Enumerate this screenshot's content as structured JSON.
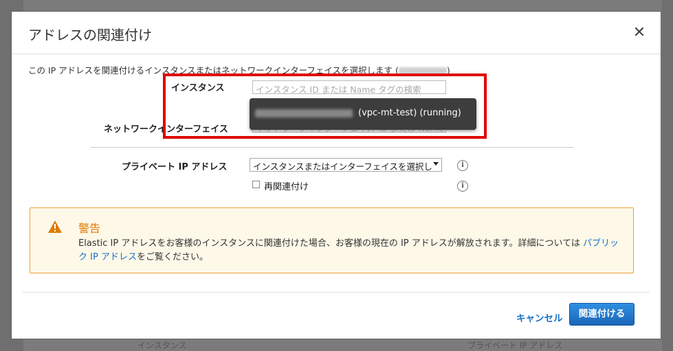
{
  "dialog": {
    "title": "アドレスの関連付け",
    "close_label": "✕",
    "description_prefix": "この IP アドレスを関連付けるインスタンスまたはネットワークインターフェイスを選択します (",
    "description_suffix": ")"
  },
  "form": {
    "instance_label": "インスタンス",
    "instance_placeholder": "インスタンス ID または Name タグの検索",
    "instance_suggestion": "(vpc-mt-test) (running)",
    "eni_label": "ネットワークインターフェイス",
    "eni_placeholder": "ネットワークインターフェイス ID または Name タ",
    "private_ip_label": "プライベート IP アドレス",
    "private_ip_select": "インスタンスまたはインターフェイスを選択し",
    "reassociate_label": "再関連付け",
    "reassociate_checked": false
  },
  "warning": {
    "title": "警告",
    "text_1": "Elastic IP アドレスをお客様のインスタンスに関連付けた場合、お客様の現在の IP アドレスが解放されます。詳細については",
    "link_part1": "パブリッ",
    "text_line2_link": "ク IP アドレス",
    "text_2": "をご覧ください。",
    "accent_color": "#e07b00"
  },
  "footer": {
    "cancel_label": "キャンセル",
    "submit_label": "関連付ける"
  },
  "background": {
    "left_text": "インスタンス",
    "right_text": "プライベート IP アドレス"
  }
}
